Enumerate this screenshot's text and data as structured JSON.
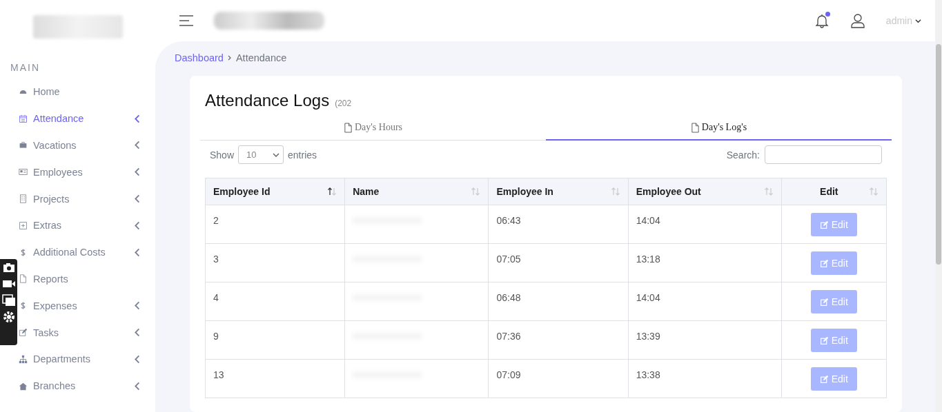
{
  "header": {
    "user": {
      "name": "admin"
    },
    "notifications": {
      "unread": true
    }
  },
  "sidebar": {
    "section": "MAIN",
    "items": [
      {
        "label": "Home",
        "selected": false,
        "expandable": false
      },
      {
        "label": "Attendance",
        "selected": true,
        "expandable": true
      },
      {
        "label": "Vacations",
        "selected": false,
        "expandable": true
      },
      {
        "label": "Employees",
        "selected": false,
        "expandable": true
      },
      {
        "label": "Projects",
        "selected": false,
        "expandable": true
      },
      {
        "label": "Extras",
        "selected": false,
        "expandable": true
      },
      {
        "label": "Additional Costs",
        "selected": false,
        "expandable": true
      },
      {
        "label": "Reports",
        "selected": false,
        "expandable": false
      },
      {
        "label": "Expenses",
        "selected": false,
        "expandable": true
      },
      {
        "label": "Tasks",
        "selected": false,
        "expandable": true
      },
      {
        "label": "Departments",
        "selected": false,
        "expandable": true
      },
      {
        "label": "Branches",
        "selected": false,
        "expandable": true
      }
    ]
  },
  "breadcrumb": [
    {
      "label": "Dashboard",
      "link": true
    },
    {
      "label": "Attendance",
      "link": false
    }
  ],
  "card": {
    "title": "Attendance Logs",
    "subtitle": "(202",
    "tabs": [
      {
        "label": "Day's Hours",
        "selected": false
      },
      {
        "label": "Day's Log's",
        "selected": true
      }
    ],
    "show_label": "Show",
    "page_size": "10",
    "entries_label": "entries",
    "search_label": "Search:",
    "table": {
      "columns": [
        {
          "label": "Employee Id",
          "sorted": true
        },
        {
          "label": "Name",
          "sorted": false
        },
        {
          "label": "Employee In",
          "sorted": false
        },
        {
          "label": "Employee Out",
          "sorted": false
        },
        {
          "label": "Edit",
          "sorted": false
        }
      ],
      "rows": [
        {
          "id": "2",
          "in": "06:43",
          "out": "14:04",
          "action": "Edit"
        },
        {
          "id": "3",
          "in": "07:05",
          "out": "13:18",
          "action": "Edit"
        },
        {
          "id": "4",
          "in": "06:48",
          "out": "14:04",
          "action": "Edit"
        },
        {
          "id": "9",
          "in": "07:36",
          "out": "13:39",
          "action": "Edit"
        },
        {
          "id": "13",
          "in": "07:09",
          "out": "13:38",
          "action": "Edit"
        }
      ]
    }
  }
}
